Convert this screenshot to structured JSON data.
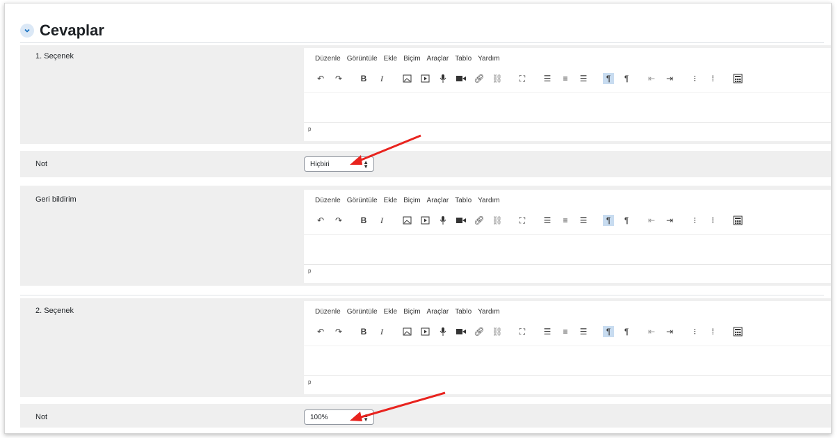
{
  "section": {
    "title": "Cevaplar"
  },
  "editor_menu": [
    "Düzenle",
    "Görüntüle",
    "Ekle",
    "Biçim",
    "Araçlar",
    "Tablo",
    "Yardım"
  ],
  "path_label": "p",
  "rows": [
    {
      "label": "1. Seçenek"
    },
    {
      "label": "Not",
      "value": "Hiçbiri"
    },
    {
      "label": "Geri bildirim"
    },
    {
      "label": "2. Seçenek"
    },
    {
      "label": "Not",
      "value": "100%"
    }
  ],
  "colors": {
    "annotation_arrow": "#e8231e",
    "active_button": "#c8dcf0"
  }
}
